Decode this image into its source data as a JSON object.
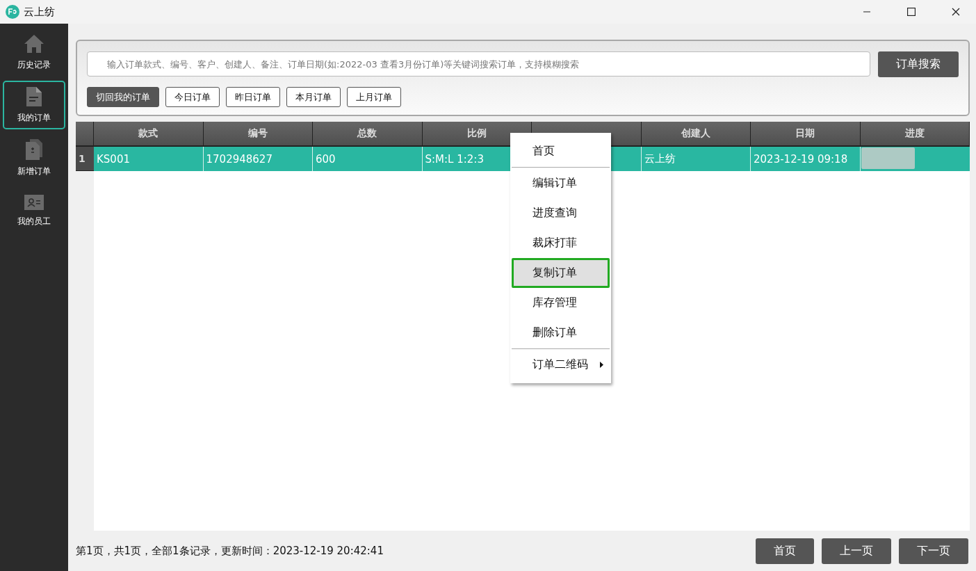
{
  "window": {
    "title": "云上纺"
  },
  "sidebar": {
    "items": [
      {
        "label": "历史记录",
        "kind": "home",
        "selected": false
      },
      {
        "label": "我的订单",
        "kind": "doc",
        "selected": true
      },
      {
        "label": "新增订单",
        "kind": "docs",
        "selected": false
      },
      {
        "label": "我的员工",
        "kind": "card",
        "selected": false
      }
    ]
  },
  "search": {
    "placeholder": "输入订单款式、编号、客户、创建人、备注、订单日期(如:2022-03 查看3月份订单)等关键词搜索订单，支持模糊搜索",
    "button": "订单搜索"
  },
  "filters": [
    {
      "label": "切回我的订单",
      "selected": true
    },
    {
      "label": "今日订单",
      "selected": false
    },
    {
      "label": "昨日订单",
      "selected": false
    },
    {
      "label": "本月订单",
      "selected": false
    },
    {
      "label": "上月订单",
      "selected": false
    }
  ],
  "table": {
    "columns": [
      "款式",
      "编号",
      "总数",
      "比例",
      null,
      "创建人",
      "日期",
      "进度"
    ],
    "rows": [
      {
        "index": "1",
        "selected": true,
        "cells": [
          "KS001",
          "1702948627",
          "600",
          "S:M:L 1:2:3",
          null,
          "云上纺",
          "2023-12-19 09:18"
        ],
        "progress": {
          "level": 0.5
        }
      }
    ]
  },
  "context_menu": {
    "items": [
      {
        "kind": "item",
        "label": "首页",
        "selected": false
      },
      {
        "kind": "separator"
      },
      {
        "kind": "item",
        "label": "编辑订单",
        "selected": false
      },
      {
        "kind": "item",
        "label": "进度查询",
        "selected": false
      },
      {
        "kind": "item",
        "label": "裁床打菲",
        "selected": false
      },
      {
        "kind": "item",
        "label": "复制订单",
        "selected": true
      },
      {
        "kind": "item",
        "label": "库存管理",
        "selected": false
      },
      {
        "kind": "item",
        "label": "删除订单",
        "selected": false
      },
      {
        "kind": "separator"
      },
      {
        "kind": "submenu",
        "label": "订单二维码",
        "selected": false
      }
    ]
  },
  "status_bar": {
    "text": "第1页，共1页，全部1条记录，更新时间：2023-12-19 20:42:41",
    "buttons": [
      "首页",
      "上一页",
      "下一页"
    ]
  }
}
